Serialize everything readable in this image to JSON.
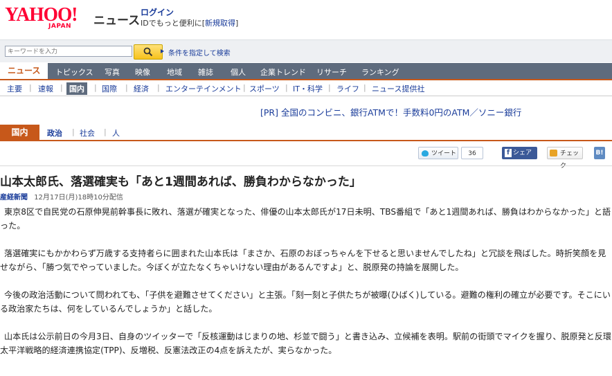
{
  "header": {
    "logo": "YAHOO!",
    "logo_sub": "JAPAN",
    "service": "ニュース",
    "login": "ログイン",
    "id_note_prefix": "IDでもっと便利に[",
    "register": "新規取得",
    "id_note_suffix": "]"
  },
  "search": {
    "placeholder": "キーワードを入力",
    "conditions": "条件を指定して検索"
  },
  "main_nav": [
    "ニュース",
    "トピックス",
    "写真",
    "映像",
    "地域",
    "雑誌",
    "個人",
    "企業トレンド",
    "リサーチ",
    "ランキング"
  ],
  "sub_nav": [
    "主要",
    "速報",
    "国内",
    "国際",
    "経済",
    "エンターテインメント",
    "スポーツ",
    "IT・科学",
    "ライフ",
    "ニュース提供社"
  ],
  "pr": "[PR] 全国のコンビニ、銀行ATMで！手数料0円のATM／ソニー銀行",
  "section_tabs": [
    "国内",
    "政治",
    "社会",
    "人"
  ],
  "social": {
    "tweet": "ツイート",
    "tweet_count": "36",
    "share": "シェア",
    "check": "チェック",
    "hatena": "B!"
  },
  "article": {
    "title": "山本太郎氏、落選確実も「あと1週間あれば、勝負わからなかった」",
    "source": "産経新聞",
    "date": "12月17日(月)18時10分配信",
    "paragraphs": [
      "東京8区で自民党の石原伸晃前幹事長に敗れ、落選が確実となった、俳優の山本太郎氏が17日未明、TBS番組で「あと1週間あれば、勝負はわからなかった」と語った。",
      "落選確実にもかかわらず万歳する支持者らに囲まれた山本氏は「まさか、石原のおぼっちゃんを下せると思いませんでしたね」と冗談を飛ばした。時折笑顔を見せながら、「勝つ気でやっていました。今ぼくが立たなくちゃいけない理由があるんですよ」と、脱原発の持論を展開した。",
      "今後の政治活動について問われても、「子供を避難させてください」と主張。「刻一刻と子供たちが被曝(ひばく)している。避難の権利の確立が必要です。そこにいる政治家たちは、何をしているんでしょうか」と話した。",
      "山本氏は公示前日の今月3日、自身のツイッターで「反核運動はじまりの地、杉並で闘う」と書き込み、立候補を表明。駅前の街頭でマイクを握り、脱原発と反環太平洋戦略的経済連携協定(TPP)、反増税、反憲法改正の4点を訴えたが、実らなかった。"
    ]
  },
  "colors": {
    "brand_red": "#ff0033",
    "nav_bg": "#5e6b7d",
    "accent_orange": "#c7581a",
    "link_blue": "#1a3c9a"
  }
}
